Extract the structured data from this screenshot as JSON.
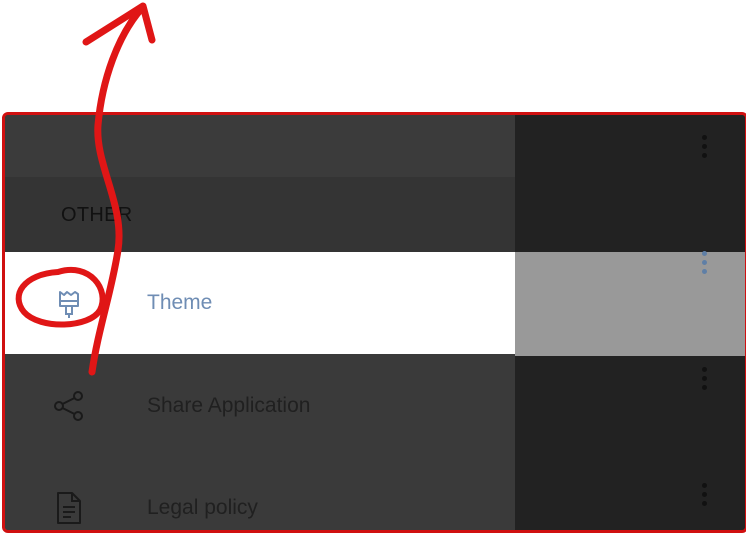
{
  "colors": {
    "annotation": "#e01616",
    "overlay": "#3a3a3a",
    "selected_bg": "#ffffff",
    "selected_text": "#6f8db4",
    "right_panel": "#222222",
    "right_highlight": "#999999"
  },
  "section": {
    "title": "OTHER"
  },
  "menu": {
    "items": [
      {
        "label": "Theme",
        "icon": "paint-brush-icon",
        "selected": true
      },
      {
        "label": "Share Application",
        "icon": "share-icon",
        "selected": false
      },
      {
        "label": "Legal policy",
        "icon": "document-icon",
        "selected": false
      }
    ]
  },
  "right_panel": {
    "menu_icon": "more-vertical-icon"
  }
}
